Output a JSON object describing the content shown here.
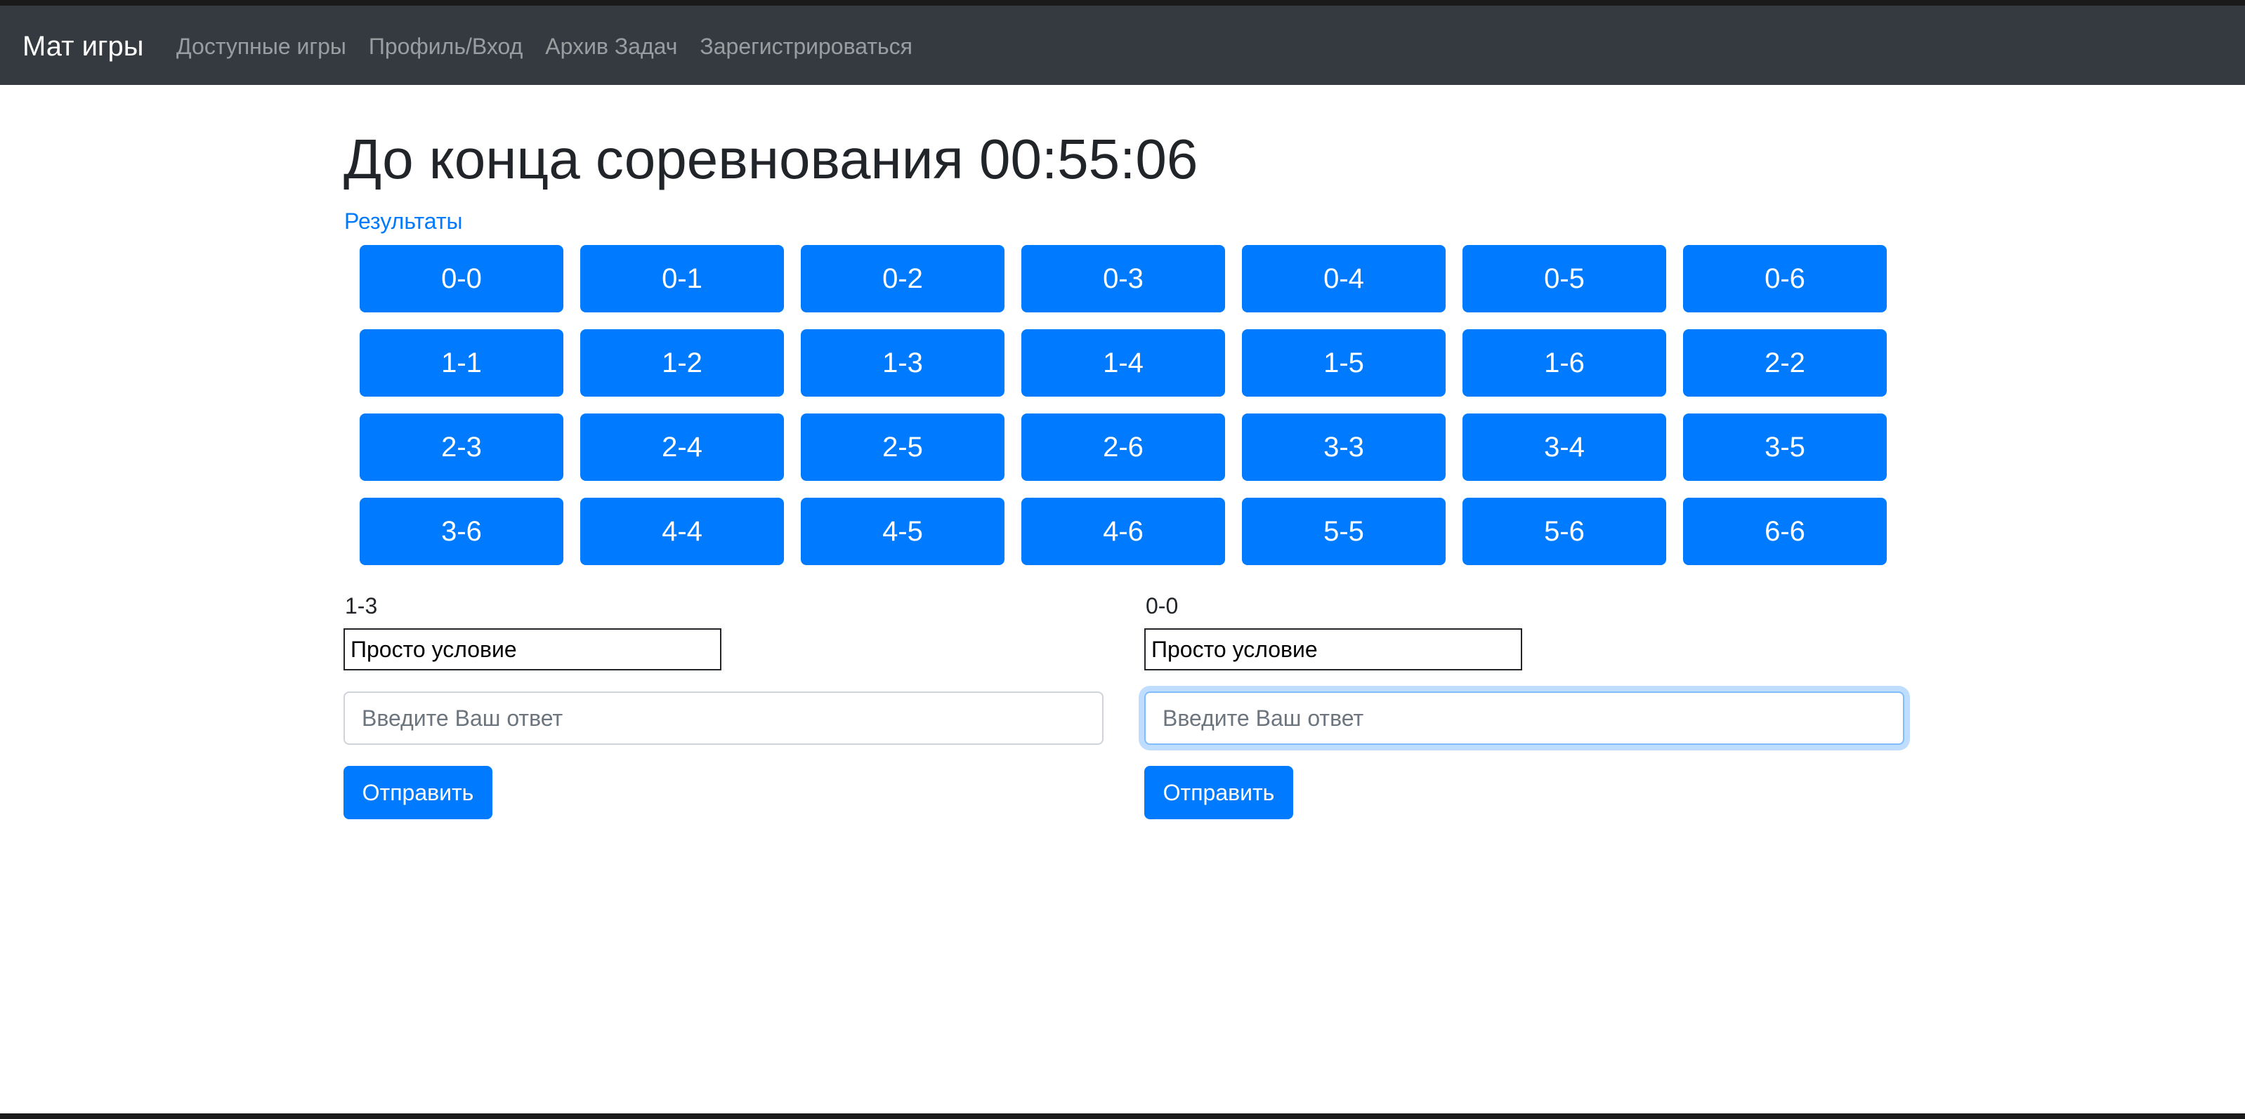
{
  "navbar": {
    "brand": "Мат игры",
    "links": [
      {
        "label": "Доступные игры"
      },
      {
        "label": "Профиль/Вход"
      },
      {
        "label": "Архив Задач"
      },
      {
        "label": "Зарегистрироваться"
      }
    ]
  },
  "main": {
    "heading": "До конца соревнования 00:55:06",
    "results_link": "Результаты",
    "task_buttons": [
      "0-0",
      "0-1",
      "0-2",
      "0-3",
      "0-4",
      "0-5",
      "0-6",
      "1-1",
      "1-2",
      "1-3",
      "1-4",
      "1-5",
      "1-6",
      "2-2",
      "2-3",
      "2-4",
      "2-5",
      "2-6",
      "3-3",
      "3-4",
      "3-5",
      "3-6",
      "4-4",
      "4-5",
      "4-6",
      "5-5",
      "5-6",
      "6-6"
    ],
    "panels": [
      {
        "task_label": "1-3",
        "condition": "Просто условие",
        "answer_value": "",
        "answer_placeholder": "Введите Ваш ответ",
        "submit_label": "Отправить",
        "focused": false
      },
      {
        "task_label": "0-0",
        "condition": "Просто условие",
        "answer_value": "",
        "answer_placeholder": "Введите Ваш ответ",
        "submit_label": "Отправить",
        "focused": true
      }
    ]
  },
  "colors": {
    "navbar_bg": "#343a40",
    "primary": "#007bff",
    "text": "#212529",
    "focus_border": "#80bdff"
  }
}
